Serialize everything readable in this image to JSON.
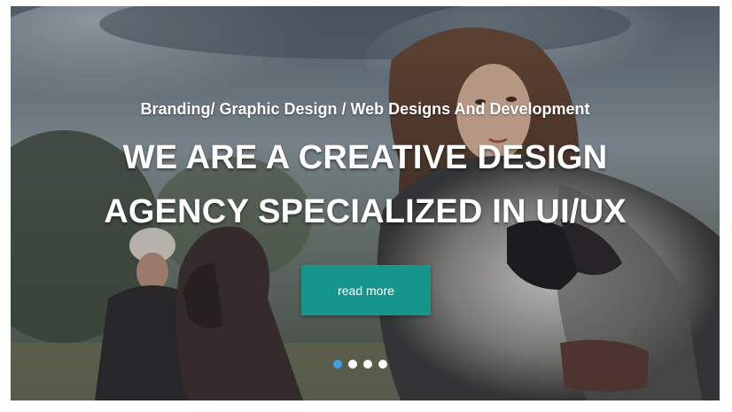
{
  "hero": {
    "subtitle": "Branding/ Graphic Design / Web Designs And Development",
    "headline_line1": "WE ARE A CREATIVE DESIGN",
    "headline_line2": "AGENCY SPECIALIZED IN UI/UX",
    "cta_label": "read more"
  },
  "slider": {
    "slide_count": 4,
    "active_index": 0,
    "active_dot_color": "#3a9ee0",
    "dot_color": "#ffffff"
  },
  "colors": {
    "button": "#16968a"
  }
}
